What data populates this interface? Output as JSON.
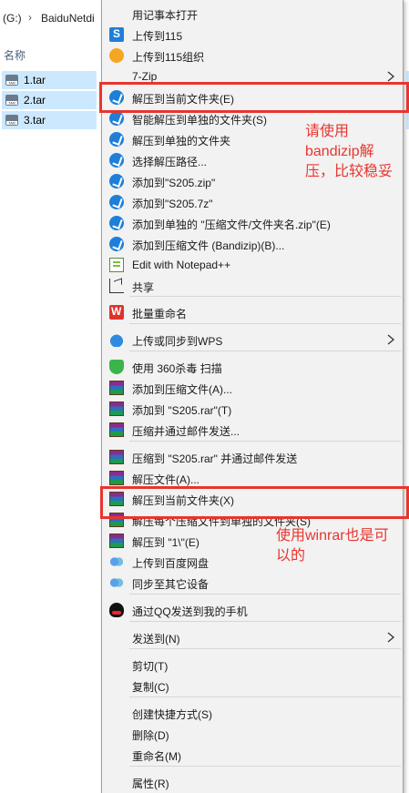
{
  "explorer": {
    "drive": "(G:)",
    "separator": "›",
    "crumb": "BaiduNetdi",
    "column_name": "名称",
    "files": [
      {
        "name": "1.tar",
        "icon": "tar-file-icon"
      },
      {
        "name": "2.tar",
        "icon": "tar-file-icon"
      },
      {
        "name": "3.tar",
        "icon": "tar-file-icon"
      }
    ]
  },
  "menu": {
    "items": [
      {
        "label": "用记事本打开",
        "icon": ""
      },
      {
        "label": "上传到115",
        "icon": "115-icon"
      },
      {
        "label": "上传到115组织",
        "icon": "115-org-icon"
      },
      {
        "label": "7-Zip",
        "icon": "",
        "submenu": true
      },
      {
        "label": "解压到当前文件夹(E)",
        "icon": "bandizip-icon"
      },
      {
        "label": "智能解压到单独的文件夹(S)",
        "icon": "bandizip-icon"
      },
      {
        "label": "解压到单独的文件夹",
        "icon": "bandizip-icon"
      },
      {
        "label": "选择解压路径...",
        "icon": "bandizip-icon"
      },
      {
        "label": "添加到\"S205.zip\"",
        "icon": "bandizip-icon"
      },
      {
        "label": "添加到\"S205.7z\"",
        "icon": "bandizip-icon"
      },
      {
        "label": "添加到单独的 \"压缩文件/文件夹名.zip\"(E)",
        "icon": "bandizip-icon"
      },
      {
        "label": "添加到压缩文件 (Bandizip)(B)...",
        "icon": "bandizip-icon"
      },
      {
        "label": "Edit with Notepad++",
        "icon": "notepad-plus-icon"
      },
      {
        "label": "共享",
        "icon": "share-icon"
      },
      {
        "label": "批量重命名",
        "icon": "wps-rename-icon"
      },
      {
        "label": "上传或同步到WPS",
        "icon": "wps-cloud-icon",
        "submenu": true
      },
      {
        "label": "使用 360杀毒 扫描",
        "icon": "360-icon"
      },
      {
        "label": "添加到压缩文件(A)...",
        "icon": "winrar-icon"
      },
      {
        "label": "添加到 \"S205.rar\"(T)",
        "icon": "winrar-icon"
      },
      {
        "label": "压缩并通过邮件发送...",
        "icon": "winrar-icon"
      },
      {
        "label": "压缩到 \"S205.rar\" 并通过邮件发送",
        "icon": "winrar-icon"
      },
      {
        "label": "解压文件(A)...",
        "icon": "winrar-icon"
      },
      {
        "label": "解压到当前文件夹(X)",
        "icon": "winrar-icon"
      },
      {
        "label": "解压每个压缩文件到单独的文件夹(S)",
        "icon": "winrar-icon"
      },
      {
        "label": "解压到 \"1\\\"(E)",
        "icon": "winrar-icon"
      },
      {
        "label": "上传到百度网盘",
        "icon": "baidu-icon"
      },
      {
        "label": "同步至其它设备",
        "icon": "baidu-icon"
      },
      {
        "label": "通过QQ发送到我的手机",
        "icon": "qq-icon"
      },
      {
        "label": "发送到(N)",
        "icon": "",
        "submenu": true
      },
      {
        "label": "剪切(T)",
        "icon": ""
      },
      {
        "label": "复制(C)",
        "icon": ""
      },
      {
        "label": "创建快捷方式(S)",
        "icon": ""
      },
      {
        "label": "删除(D)",
        "icon": ""
      },
      {
        "label": "重命名(M)",
        "icon": ""
      },
      {
        "label": "属性(R)",
        "icon": ""
      }
    ]
  },
  "annotations": {
    "bandizip_note": "请使用\nbandizip解\n压，比较稳妥",
    "winrar_note": "使用winrar也是可\n以的",
    "color": "#e8352e"
  }
}
